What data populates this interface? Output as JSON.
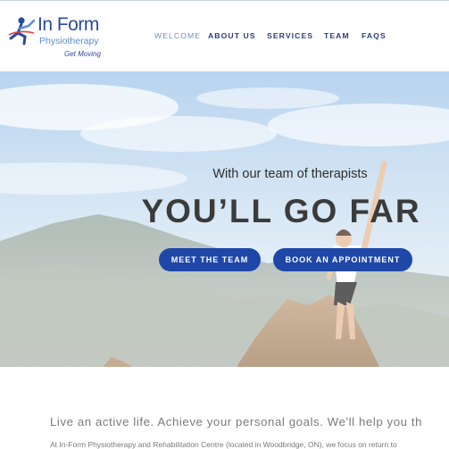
{
  "brand": {
    "name": "In Form",
    "subtitle": "Physiotherapy",
    "tagline": "Get Moving"
  },
  "nav": {
    "items": [
      "WELCOME",
      "ABOUT US",
      "SERVICES",
      "TEAM",
      "FAQS"
    ],
    "active": "WELCOME"
  },
  "hero": {
    "subheading": "With our team of therapists",
    "heading": "YOU’LL GO FAR",
    "buttons": {
      "team": "MEET THE TEAM",
      "appointment": "BOOK AN APPOINTMENT"
    }
  },
  "content": {
    "tagline": "Live an active life. Achieve your personal goals. We'll help you th",
    "intro": "At In-Form Physiotherapy and Rehabilitation Centre (located in Woodbridge, ON), we focus on return to"
  },
  "colors": {
    "brand_blue": "#2a4b9b",
    "button_blue": "#1f47a8",
    "nav_text": "#2c3f78"
  }
}
